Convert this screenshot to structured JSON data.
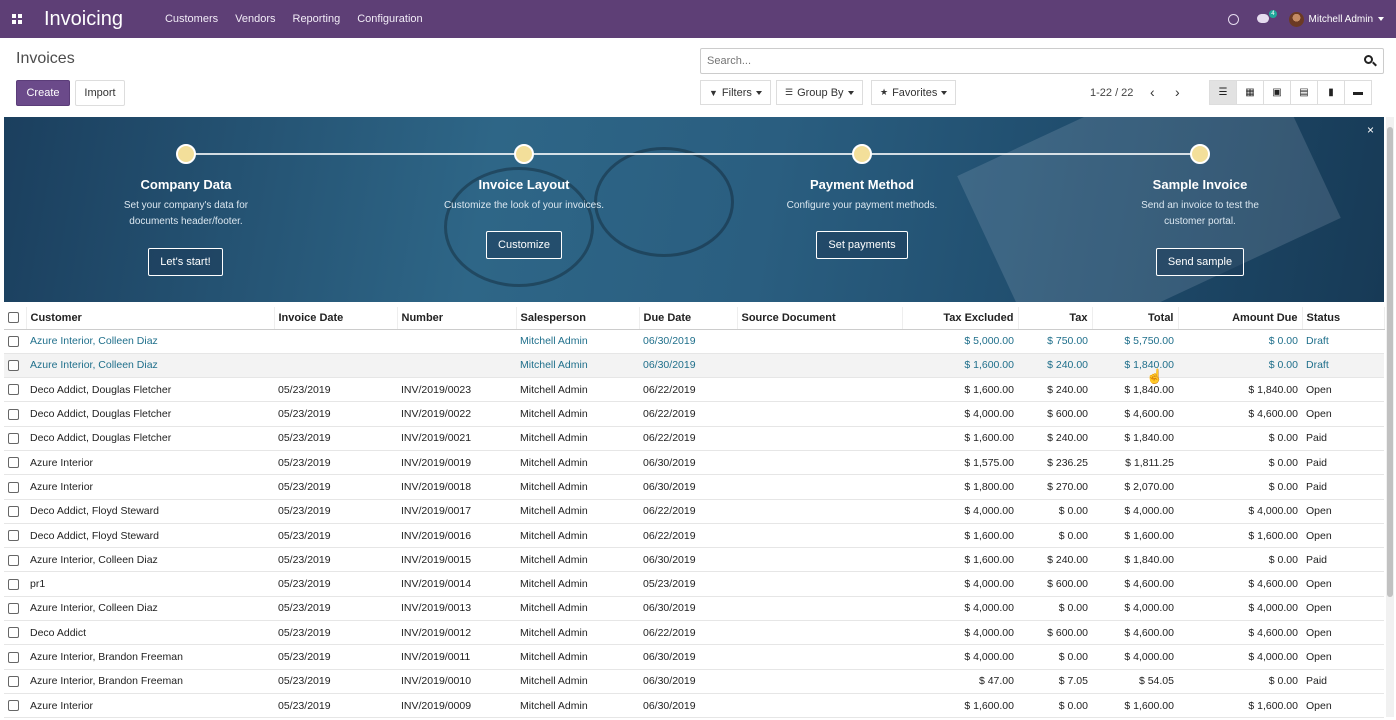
{
  "app": {
    "brand": "Invoicing",
    "menu": [
      "Customers",
      "Vendors",
      "Reporting",
      "Configuration"
    ],
    "chat_badge": "4",
    "user_name": "Mitchell Admin"
  },
  "control_panel": {
    "title": "Invoices",
    "create_label": "Create",
    "import_label": "Import",
    "search_placeholder": "Search...",
    "filters_label": "Filters",
    "groupby_label": "Group By",
    "favorites_label": "Favorites",
    "pager": "1-22 / 22"
  },
  "banner": {
    "close": "×",
    "steps": [
      {
        "title": "Company Data",
        "desc1": "Set your company's data for",
        "desc2": "documents header/footer.",
        "button": "Let's start!"
      },
      {
        "title": "Invoice Layout",
        "desc1": "Customize the look of your invoices.",
        "desc2": "",
        "button": "Customize"
      },
      {
        "title": "Payment Method",
        "desc1": "Configure your payment methods.",
        "desc2": "",
        "button": "Set payments"
      },
      {
        "title": "Sample Invoice",
        "desc1": "Send an invoice to test the",
        "desc2": "customer portal.",
        "button": "Send sample"
      }
    ]
  },
  "table": {
    "headers": [
      "Customer",
      "Invoice Date",
      "Number",
      "Salesperson",
      "Due Date",
      "Source Document",
      "Tax Excluded",
      "Tax",
      "Total",
      "Amount Due",
      "Status"
    ],
    "rows": [
      {
        "customer": "Azure Interior, Colleen Diaz",
        "date": "",
        "number": "",
        "sp": "Mitchell Admin",
        "due": "06/30/2019",
        "src": "",
        "taxex": "$ 5,000.00",
        "tax": "$ 750.00",
        "total": "$ 5,750.00",
        "due_amt": "$ 0.00",
        "status": "Draft"
      },
      {
        "customer": "Azure Interior, Colleen Diaz",
        "date": "",
        "number": "",
        "sp": "Mitchell Admin",
        "due": "06/30/2019",
        "src": "",
        "taxex": "$ 1,600.00",
        "tax": "$ 240.00",
        "total": "$ 1,840.00",
        "due_amt": "$ 0.00",
        "status": "Draft"
      },
      {
        "customer": "Deco Addict, Douglas Fletcher",
        "date": "05/23/2019",
        "number": "INV/2019/0023",
        "sp": "Mitchell Admin",
        "due": "06/22/2019",
        "src": "",
        "taxex": "$ 1,600.00",
        "tax": "$ 240.00",
        "total": "$ 1,840.00",
        "due_amt": "$ 1,840.00",
        "status": "Open"
      },
      {
        "customer": "Deco Addict, Douglas Fletcher",
        "date": "05/23/2019",
        "number": "INV/2019/0022",
        "sp": "Mitchell Admin",
        "due": "06/22/2019",
        "src": "",
        "taxex": "$ 4,000.00",
        "tax": "$ 600.00",
        "total": "$ 4,600.00",
        "due_amt": "$ 4,600.00",
        "status": "Open"
      },
      {
        "customer": "Deco Addict, Douglas Fletcher",
        "date": "05/23/2019",
        "number": "INV/2019/0021",
        "sp": "Mitchell Admin",
        "due": "06/22/2019",
        "src": "",
        "taxex": "$ 1,600.00",
        "tax": "$ 240.00",
        "total": "$ 1,840.00",
        "due_amt": "$ 0.00",
        "status": "Paid"
      },
      {
        "customer": "Azure Interior",
        "date": "05/23/2019",
        "number": "INV/2019/0019",
        "sp": "Mitchell Admin",
        "due": "06/30/2019",
        "src": "",
        "taxex": "$ 1,575.00",
        "tax": "$ 236.25",
        "total": "$ 1,811.25",
        "due_amt": "$ 0.00",
        "status": "Paid"
      },
      {
        "customer": "Azure Interior",
        "date": "05/23/2019",
        "number": "INV/2019/0018",
        "sp": "Mitchell Admin",
        "due": "06/30/2019",
        "src": "",
        "taxex": "$ 1,800.00",
        "tax": "$ 270.00",
        "total": "$ 2,070.00",
        "due_amt": "$ 0.00",
        "status": "Paid"
      },
      {
        "customer": "Deco Addict, Floyd Steward",
        "date": "05/23/2019",
        "number": "INV/2019/0017",
        "sp": "Mitchell Admin",
        "due": "06/22/2019",
        "src": "",
        "taxex": "$ 4,000.00",
        "tax": "$ 0.00",
        "total": "$ 4,000.00",
        "due_amt": "$ 4,000.00",
        "status": "Open"
      },
      {
        "customer": "Deco Addict, Floyd Steward",
        "date": "05/23/2019",
        "number": "INV/2019/0016",
        "sp": "Mitchell Admin",
        "due": "06/22/2019",
        "src": "",
        "taxex": "$ 1,600.00",
        "tax": "$ 0.00",
        "total": "$ 1,600.00",
        "due_amt": "$ 1,600.00",
        "status": "Open"
      },
      {
        "customer": "Azure Interior, Colleen Diaz",
        "date": "05/23/2019",
        "number": "INV/2019/0015",
        "sp": "Mitchell Admin",
        "due": "06/30/2019",
        "src": "",
        "taxex": "$ 1,600.00",
        "tax": "$ 240.00",
        "total": "$ 1,840.00",
        "due_amt": "$ 0.00",
        "status": "Paid"
      },
      {
        "customer": "pr1",
        "date": "05/23/2019",
        "number": "INV/2019/0014",
        "sp": "Mitchell Admin",
        "due": "05/23/2019",
        "src": "",
        "taxex": "$ 4,000.00",
        "tax": "$ 600.00",
        "total": "$ 4,600.00",
        "due_amt": "$ 4,600.00",
        "status": "Open"
      },
      {
        "customer": "Azure Interior, Colleen Diaz",
        "date": "05/23/2019",
        "number": "INV/2019/0013",
        "sp": "Mitchell Admin",
        "due": "06/30/2019",
        "src": "",
        "taxex": "$ 4,000.00",
        "tax": "$ 0.00",
        "total": "$ 4,000.00",
        "due_amt": "$ 4,000.00",
        "status": "Open"
      },
      {
        "customer": "Deco Addict",
        "date": "05/23/2019",
        "number": "INV/2019/0012",
        "sp": "Mitchell Admin",
        "due": "06/22/2019",
        "src": "",
        "taxex": "$ 4,000.00",
        "tax": "$ 600.00",
        "total": "$ 4,600.00",
        "due_amt": "$ 4,600.00",
        "status": "Open"
      },
      {
        "customer": "Azure Interior, Brandon Freeman",
        "date": "05/23/2019",
        "number": "INV/2019/0011",
        "sp": "Mitchell Admin",
        "due": "06/30/2019",
        "src": "",
        "taxex": "$ 4,000.00",
        "tax": "$ 0.00",
        "total": "$ 4,000.00",
        "due_amt": "$ 4,000.00",
        "status": "Open"
      },
      {
        "customer": "Azure Interior, Brandon Freeman",
        "date": "05/23/2019",
        "number": "INV/2019/0010",
        "sp": "Mitchell Admin",
        "due": "06/30/2019",
        "src": "",
        "taxex": "$ 47.00",
        "tax": "$ 7.05",
        "total": "$ 54.05",
        "due_amt": "$ 0.00",
        "status": "Paid"
      },
      {
        "customer": "Azure Interior",
        "date": "05/23/2019",
        "number": "INV/2019/0009",
        "sp": "Mitchell Admin",
        "due": "06/30/2019",
        "src": "",
        "taxex": "$ 1,600.00",
        "tax": "$ 0.00",
        "total": "$ 1,600.00",
        "due_amt": "$ 1,600.00",
        "status": "Open"
      }
    ]
  }
}
